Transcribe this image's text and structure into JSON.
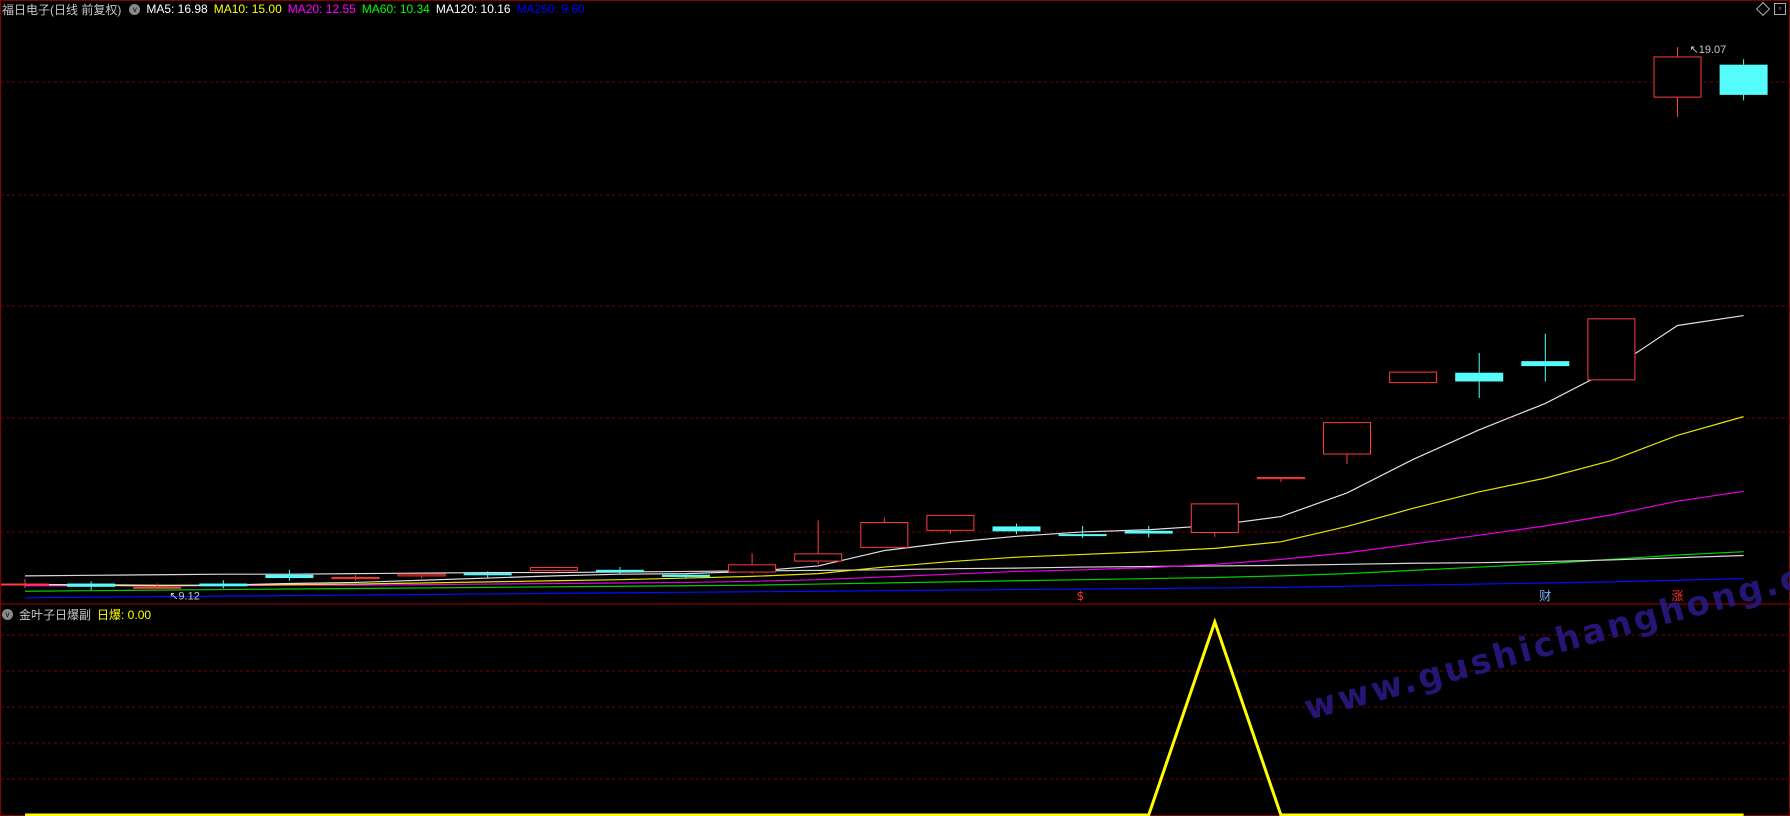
{
  "main_header": {
    "title": "福日电子(日线 前复权)",
    "indicators": [
      {
        "label": "MA5: 16.98",
        "color": "#ffffff"
      },
      {
        "label": "MA10: 15.00",
        "color": "#ffff00"
      },
      {
        "label": "MA20: 12.55",
        "color": "#ff00ff"
      },
      {
        "label": "MA60: 10.34",
        "color": "#00ff00"
      },
      {
        "label": "MA120: 10.16",
        "color": "#ffffff"
      },
      {
        "label": "MA250: 9.60",
        "color": "#0000ff"
      }
    ]
  },
  "sub_header": {
    "title": "金叶子日爆副",
    "value_label": "日爆: 0.00"
  },
  "watermark": "www.gushichanghong.com",
  "colors": {
    "up": "#ff3c3c",
    "down": "#54fcfc",
    "grid": "#7a0000",
    "ma5": "#e0e0e0",
    "ma10": "#e6e600",
    "ma20": "#e600e6",
    "ma60": "#00d000",
    "ma120": "#d8d8d8",
    "ma250": "#0a0aff",
    "sub_line": "#ffff00"
  },
  "chart_data": {
    "type": "candlestick",
    "ylim": [
      9.0,
      19.6
    ],
    "price_labels": [
      {
        "text": "19.07",
        "index": 25,
        "price": 19.07
      },
      {
        "text": "9.12",
        "index": 2,
        "price": 9.12
      }
    ],
    "marks": [
      {
        "text": "$",
        "index": 16,
        "color": "#ff3030"
      },
      {
        "text": "财",
        "index": 23,
        "color": "#7fb0ff"
      },
      {
        "text": "涨",
        "index": 25,
        "color": "#ff3030"
      }
    ],
    "candles": [
      {
        "o": 9.3,
        "c": 9.3,
        "h": 9.38,
        "l": 9.22
      },
      {
        "o": 9.3,
        "c": 9.24,
        "h": 9.34,
        "l": 9.18
      },
      {
        "o": 9.24,
        "c": 9.24,
        "h": 9.3,
        "l": 9.2
      },
      {
        "o": 9.3,
        "c": 9.25,
        "h": 9.36,
        "l": 9.21
      },
      {
        "o": 9.46,
        "c": 9.4,
        "h": 9.55,
        "l": 9.35
      },
      {
        "o": 9.38,
        "c": 9.42,
        "h": 9.45,
        "l": 9.35
      },
      {
        "o": 9.43,
        "c": 9.48,
        "h": 9.49,
        "l": 9.4
      },
      {
        "o": 9.49,
        "c": 9.45,
        "h": 9.52,
        "l": 9.4
      },
      {
        "o": 9.53,
        "c": 9.6,
        "h": 9.6,
        "l": 9.48
      },
      {
        "o": 9.55,
        "c": 9.52,
        "h": 9.6,
        "l": 9.48
      },
      {
        "o": 9.46,
        "c": 9.42,
        "h": 9.48,
        "l": 9.4
      },
      {
        "o": 9.5,
        "c": 9.65,
        "h": 9.85,
        "l": 9.48
      },
      {
        "o": 9.7,
        "c": 9.85,
        "h": 10.45,
        "l": 9.65
      },
      {
        "o": 9.95,
        "c": 10.42,
        "h": 10.5,
        "l": 9.95
      },
      {
        "o": 10.26,
        "c": 10.55,
        "h": 10.55,
        "l": 10.2
      },
      {
        "o": 10.34,
        "c": 10.25,
        "h": 10.39,
        "l": 10.2
      },
      {
        "o": 10.2,
        "c": 10.17,
        "h": 10.35,
        "l": 10.13
      },
      {
        "o": 10.26,
        "c": 10.21,
        "h": 10.35,
        "l": 10.14
      },
      {
        "o": 10.22,
        "c": 10.76,
        "h": 10.76,
        "l": 10.15
      },
      {
        "o": 11.2,
        "c": 11.24,
        "h": 11.24,
        "l": 11.15
      },
      {
        "o": 11.65,
        "c": 12.24,
        "h": 12.24,
        "l": 11.48
      },
      {
        "o": 12.95,
        "c": 13.16,
        "h": 13.16,
        "l": 12.95
      },
      {
        "o": 13.14,
        "c": 12.98,
        "h": 13.5,
        "l": 12.68
      },
      {
        "o": 13.35,
        "c": 13.26,
        "h": 13.85,
        "l": 12.98
      },
      {
        "o": 13.0,
        "c": 14.13,
        "h": 14.13,
        "l": 13.0
      },
      {
        "o": 18.15,
        "c": 18.9,
        "h": 19.07,
        "l": 17.8
      },
      {
        "o": 18.75,
        "c": 18.2,
        "h": 18.85,
        "l": 18.1
      }
    ],
    "ma5": [
      9.28,
      9.27,
      9.26,
      9.27,
      9.3,
      9.32,
      9.36,
      9.4,
      9.44,
      9.47,
      9.48,
      9.52,
      9.62,
      9.9,
      10.05,
      10.16,
      10.24,
      10.28,
      10.36,
      10.52,
      10.95,
      11.56,
      12.1,
      12.58,
      13.2,
      14.0,
      14.18
    ],
    "ma10": [
      9.28,
      9.28,
      9.27,
      9.27,
      9.28,
      9.29,
      9.31,
      9.33,
      9.35,
      9.37,
      9.4,
      9.43,
      9.48,
      9.6,
      9.7,
      9.78,
      9.83,
      9.88,
      9.94,
      10.06,
      10.34,
      10.67,
      10.97,
      11.22,
      11.54,
      12.0,
      12.34
    ],
    "ma20": [
      9.26,
      9.26,
      9.26,
      9.26,
      9.27,
      9.27,
      9.28,
      9.29,
      9.3,
      9.31,
      9.32,
      9.34,
      9.37,
      9.42,
      9.47,
      9.52,
      9.55,
      9.59,
      9.65,
      9.74,
      9.86,
      10.02,
      10.18,
      10.35,
      10.55,
      10.8,
      10.98
    ],
    "ma60": [
      9.16,
      9.17,
      9.18,
      9.19,
      9.2,
      9.21,
      9.22,
      9.23,
      9.24,
      9.25,
      9.26,
      9.27,
      9.29,
      9.31,
      9.33,
      9.35,
      9.37,
      9.39,
      9.41,
      9.44,
      9.48,
      9.54,
      9.6,
      9.66,
      9.74,
      9.82,
      9.88
    ],
    "ma120": [
      9.44,
      9.45,
      9.46,
      9.47,
      9.47,
      9.48,
      9.49,
      9.5,
      9.5,
      9.51,
      9.52,
      9.53,
      9.54,
      9.55,
      9.57,
      9.58,
      9.6,
      9.61,
      9.62,
      9.63,
      9.65,
      9.67,
      9.68,
      9.7,
      9.73,
      9.77,
      9.81
    ],
    "ma250": [
      9.04,
      9.05,
      9.06,
      9.07,
      9.08,
      9.09,
      9.1,
      9.11,
      9.12,
      9.13,
      9.14,
      9.15,
      9.16,
      9.17,
      9.18,
      9.19,
      9.2,
      9.21,
      9.22,
      9.23,
      9.25,
      9.27,
      9.29,
      9.31,
      9.33,
      9.36,
      9.39
    ],
    "sub_series": [
      0,
      0,
      0,
      0,
      0,
      0,
      0,
      0,
      0,
      0,
      0,
      0,
      0,
      0,
      0,
      0,
      0,
      0,
      1,
      0,
      0,
      0,
      0,
      0,
      0,
      0,
      0
    ]
  }
}
